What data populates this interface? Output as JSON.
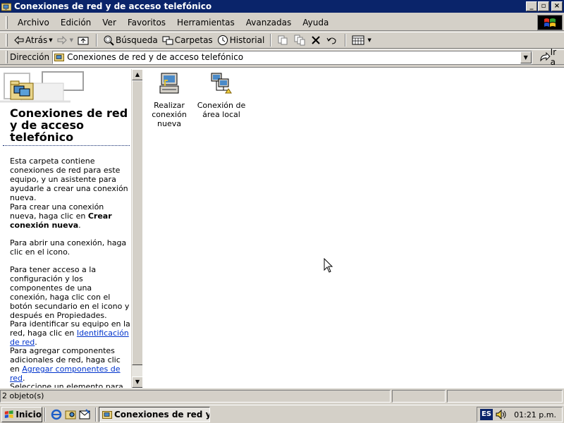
{
  "window": {
    "title": "Conexiones de red y de acceso telefónico",
    "buttons": {
      "minimize": "_",
      "maximize": "▫",
      "close": "×"
    }
  },
  "menubar": {
    "items": [
      "Archivo",
      "Edición",
      "Ver",
      "Favoritos",
      "Herramientas",
      "Avanzadas",
      "Ayuda"
    ]
  },
  "toolbar": {
    "back_label": "Atrás",
    "search_label": "Búsqueda",
    "folders_label": "Carpetas",
    "history_label": "Historial"
  },
  "addressbar": {
    "label": "Dirección",
    "value": "Conexiones de red y de acceso telefónico",
    "go_label": "Ir a"
  },
  "leftpane": {
    "folder_title": "Conexiones de red y de acceso telefónico",
    "p1": "Esta carpeta contiene conexiones de red para este equipo, y un asistente para ayudarle a crear una conexión nueva.",
    "p2_before": "Para crear una conexión nueva, haga clic en ",
    "p2_bold": "Crear conexión nueva",
    "p2_after": ".",
    "p3": "Para abrir una conexión, haga clic en el icono.",
    "p4": "Para tener acceso a la configuración y los componentes de una conexión, haga clic con el botón secundario en el icono y después en Propiedades.",
    "p5_before": "Para identificar su equipo en la red, haga clic en ",
    "p5_link": "Identificación de red",
    "p5_after": ".",
    "p6_before": "Para agregar componentes adicionales de red, haga clic en ",
    "p6_link": "Agregar componentes de red",
    "p6_after": ".",
    "p7": "Seleccione un elemento para ver su descripción."
  },
  "items": [
    {
      "label": "Realizar conexión nueva",
      "icon": "new-connection-icon"
    },
    {
      "label": "Conexión de área local",
      "icon": "lan-connection-icon"
    }
  ],
  "statusbar": {
    "text": "2 objeto(s)"
  },
  "taskbar": {
    "start_label": "Inicio",
    "task_label": "Conexiones de red y d...",
    "lang": "ES",
    "clock": "01:21 p.m."
  },
  "colors": {
    "titlebar": "#0a246a",
    "face": "#d4d0c8",
    "link": "#0033cc"
  }
}
